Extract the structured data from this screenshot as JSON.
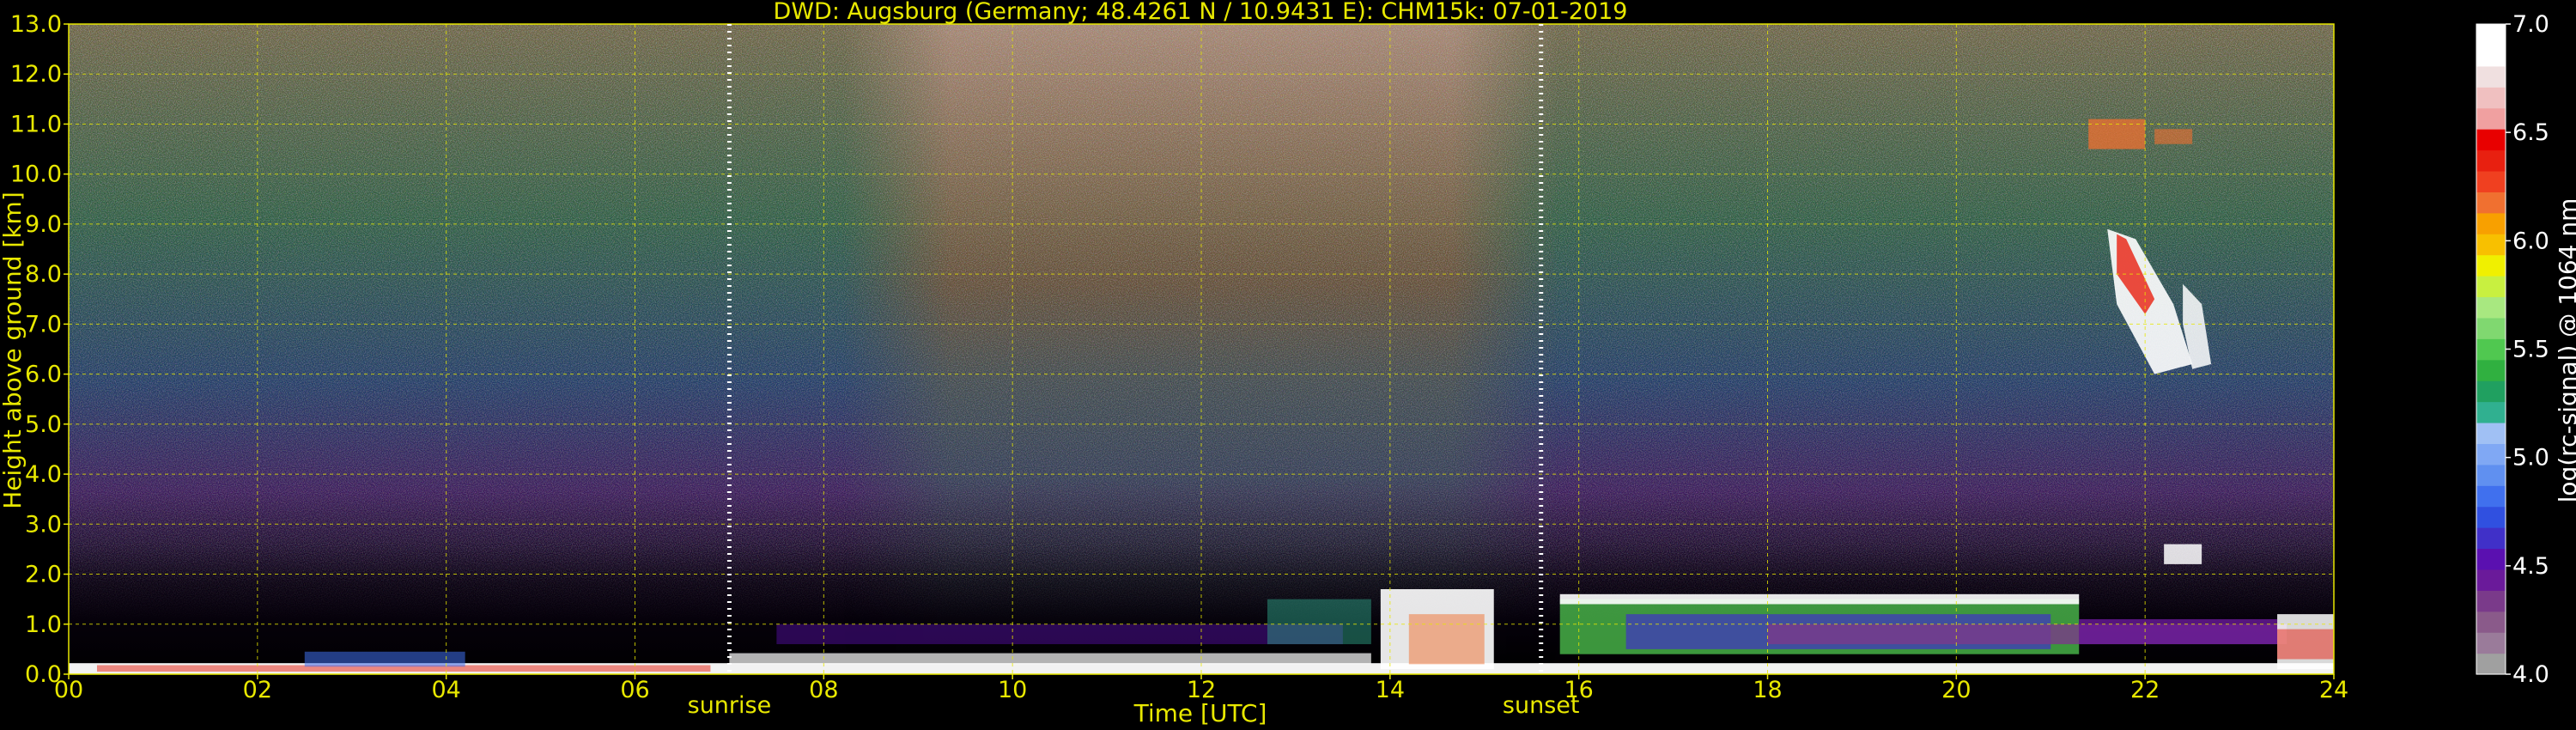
{
  "chart_data": {
    "type": "heatmap",
    "title": "DWD: Augsburg (Germany; 48.4261 N / 10.9431 E):    CHM15k: 07-01-2019",
    "xlabel": "Time [UTC]",
    "ylabel": "Height above ground [km]",
    "x_range": [
      0,
      24
    ],
    "y_range": [
      0,
      13
    ],
    "x_ticks": [
      "00",
      "02",
      "04",
      "06",
      "08",
      "10",
      "12",
      "14",
      "16",
      "18",
      "20",
      "22",
      "24"
    ],
    "y_ticks": [
      "0.0",
      "1.0",
      "2.0",
      "3.0",
      "4.0",
      "5.0",
      "6.0",
      "7.0",
      "8.0",
      "9.0",
      "10.0",
      "11.0",
      "12.0",
      "13.0"
    ],
    "grid": true,
    "markers": [
      {
        "label": "sunrise",
        "x": 7.0
      },
      {
        "label": "sunset",
        "x": 15.6
      }
    ],
    "colorbar": {
      "label": "log(rc-signal) @ 1064 nm",
      "range": [
        4.0,
        7.0
      ],
      "ticks": [
        "4.0",
        "4.5",
        "5.0",
        "5.5",
        "6.0",
        "6.5",
        "7.0"
      ],
      "colors": [
        "#a0a0a0",
        "#9a7b9a",
        "#8a5a8a",
        "#7a3a8a",
        "#6a1a9a",
        "#5a10b0",
        "#4030c8",
        "#3050e0",
        "#4070ee",
        "#6090f0",
        "#80a8f4",
        "#a0c0f4",
        "#30b090",
        "#20a060",
        "#30b040",
        "#50c850",
        "#80d870",
        "#a8e880",
        "#c8f040",
        "#f0f000",
        "#f8c000",
        "#f8a000",
        "#f07030",
        "#f04020",
        "#e82010",
        "#e80000",
        "#f0a0a0",
        "#f0c0c0",
        "#f0e0e0",
        "#ffffff",
        "#ffffff"
      ]
    }
  }
}
